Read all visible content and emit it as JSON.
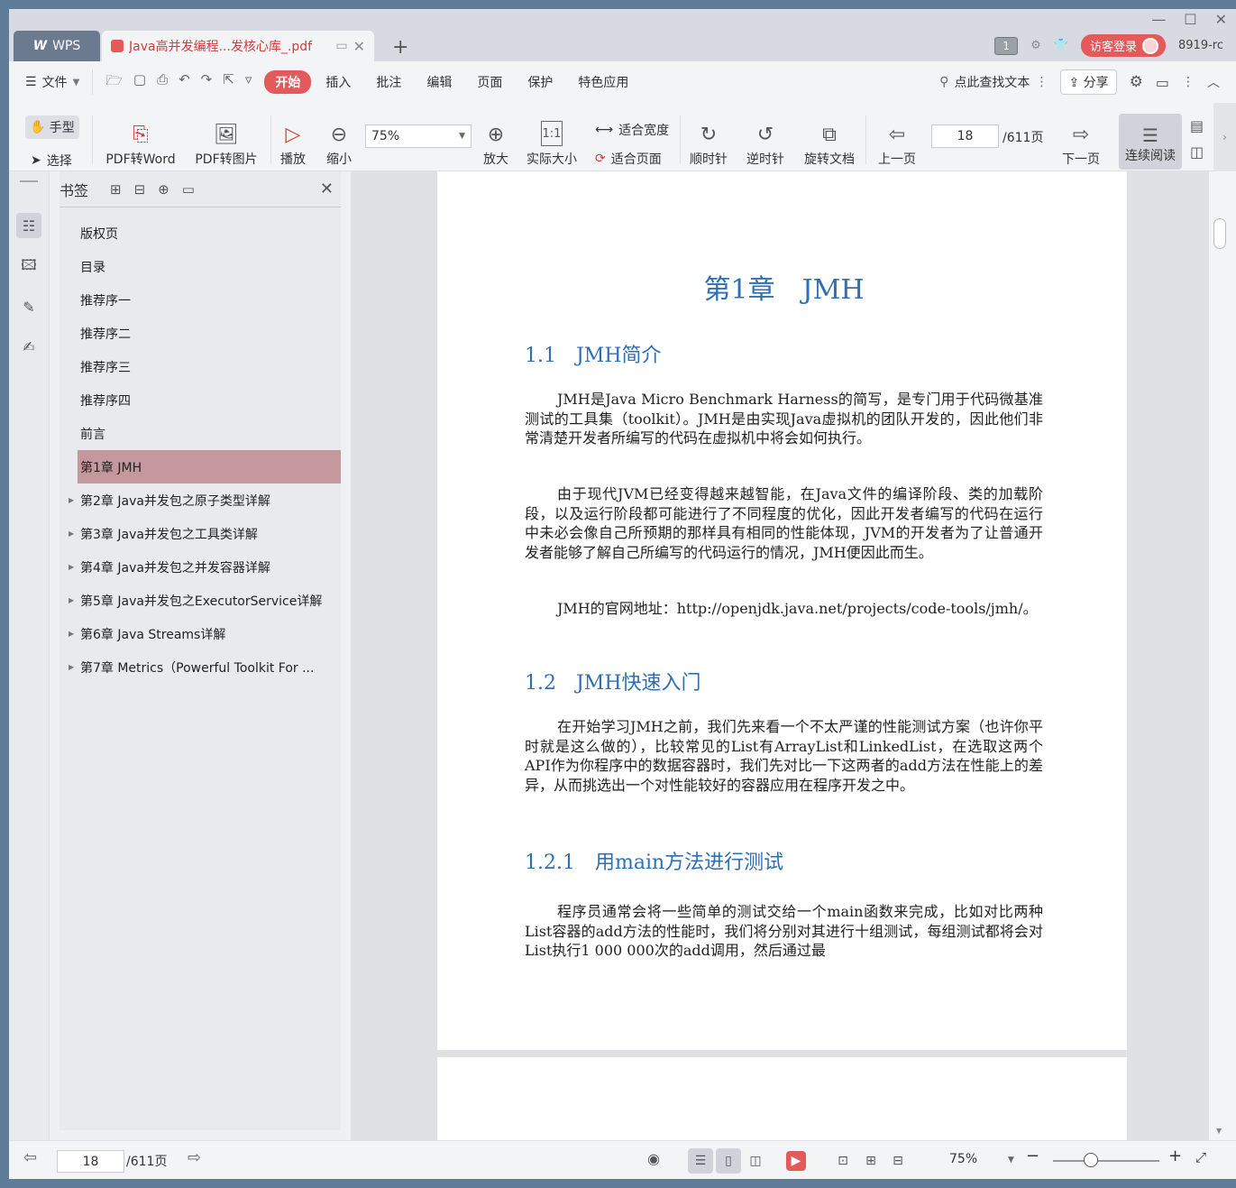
{
  "titlebar": {
    "app_tab": "WPS",
    "doc_tab": "Java高并发编程...发核心库_.pdf",
    "badge": "1",
    "login": "访客登录",
    "user": "8919-rc"
  },
  "menubar": {
    "file": "文件",
    "items": [
      "开始",
      "插入",
      "批注",
      "编辑",
      "页面",
      "保护",
      "特色应用"
    ],
    "search": "点此查找文本",
    "share": "分享"
  },
  "toolbar": {
    "hand": "手型",
    "select": "选择",
    "pdf_word": "PDF转Word",
    "pdf_image": "PDF转图片",
    "play": "播放",
    "zoom_out": "缩小",
    "zoom_value": "75%",
    "zoom_in": "放大",
    "actual_size": "实际大小",
    "fit_width": "适合宽度",
    "fit_page": "适合页面",
    "clockwise": "顺时针",
    "counter_clockwise": "逆时针",
    "rotate_doc": "旋转文档",
    "prev_page": "上一页",
    "page_num": "18",
    "page_total": "/611页",
    "next_page": "下一页",
    "continuous": "连续阅读"
  },
  "bookmarks": {
    "title": "书签",
    "items": [
      {
        "label": "版权页"
      },
      {
        "label": "目录"
      },
      {
        "label": "推荐序一"
      },
      {
        "label": "推荐序二"
      },
      {
        "label": "推荐序三"
      },
      {
        "label": "推荐序四"
      },
      {
        "label": "前言"
      },
      {
        "label": "第1章 JMH"
      },
      {
        "label": "第2章 Java并发包之原子类型详解"
      },
      {
        "label": "第3章 Java并发包之工具类详解"
      },
      {
        "label": "第4章 Java并发包之并发容器详解"
      },
      {
        "label": "第5章 Java并发包之ExecutorService详解"
      },
      {
        "label": "第6章 Java Streams详解"
      },
      {
        "label": "第7章 Metrics（Powerful Toolkit For ..."
      }
    ]
  },
  "document": {
    "chapter": "第1章　JMH",
    "s1": "1.1　JMH简介",
    "p1": "JMH是Java Micro Benchmark Harness的简写，是专门用于代码微基准测试的工具集（toolkit）。JMH是由实现Java虚拟机的团队开发的，因此他们非常清楚开发者所编写的代码在虚拟机中将会如何执行。",
    "p2": "由于现代JVM已经变得越来越智能，在Java文件的编译阶段、类的加载阶段，以及运行阶段都可能进行了不同程度的优化，因此开发者编写的代码在运行中未必会像自己所预期的那样具有相同的性能体现，JVM的开发者为了让普通开发者能够了解自己所编写的代码运行的情况，JMH便因此而生。",
    "p3": "JMH的官网地址：http://openjdk.java.net/projects/code-tools/jmh/。",
    "s2": "1.2　JMH快速入门",
    "p4": "在开始学习JMH之前，我们先来看一个不太严谨的性能测试方案（也许你平时就是这么做的），比较常见的List有ArrayList和LinkedList，在选取这两个API作为你程序中的数据容器时，我们先对比一下这两者的add方法在性能上的差异，从而挑选出一个对性能较好的容器应用在程序开发之中。",
    "s3": "1.2.1　用main方法进行测试",
    "p5": "程序员通常会将一些简单的测试交给一个main函数来完成，比如对比两种List容器的add方法的性能时，我们将分别对其进行十组测试，每组测试都将会对List执行1 000 000次的add调用，然后通过最"
  },
  "statusbar": {
    "page_num": "18",
    "page_total": "/611页",
    "zoom": "75%"
  }
}
